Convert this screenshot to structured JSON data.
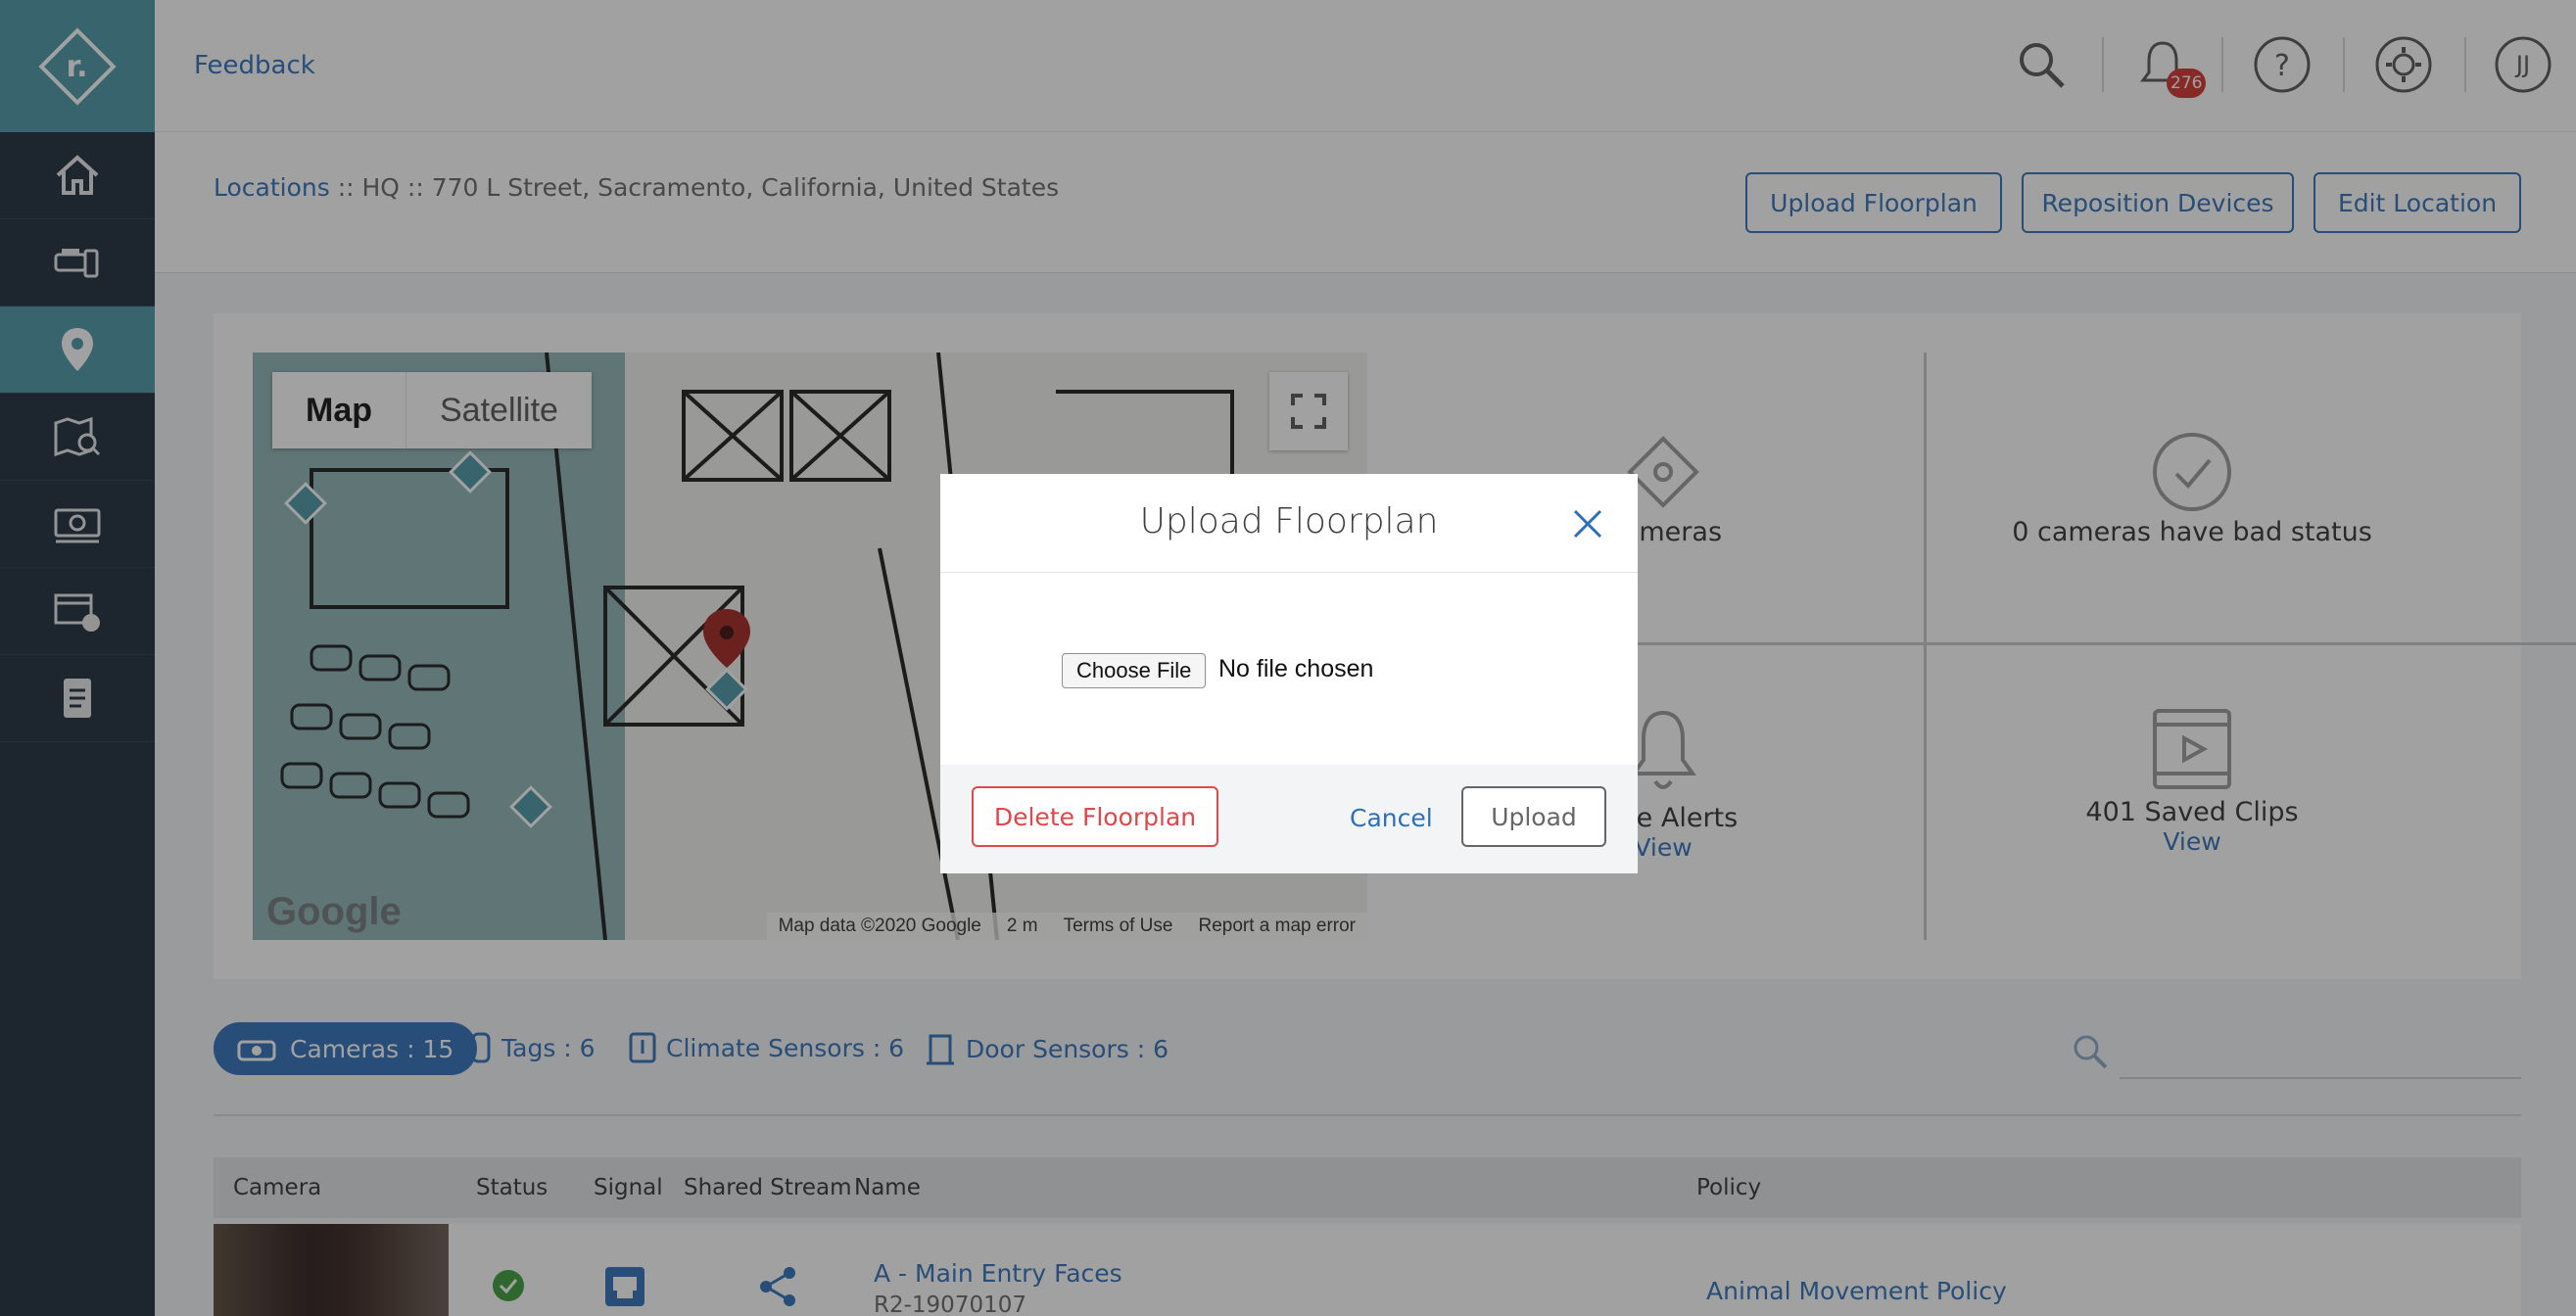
{
  "app": {
    "logo_text": "r."
  },
  "sidebar": {
    "items": [
      {
        "icon": "home-icon"
      },
      {
        "icon": "devices-icon"
      },
      {
        "icon": "location-pin-icon",
        "active": true
      },
      {
        "icon": "map-search-icon"
      },
      {
        "icon": "camera-icon"
      },
      {
        "icon": "video-clips-icon"
      },
      {
        "icon": "reports-icon"
      }
    ]
  },
  "header": {
    "feedback": "Feedback",
    "notification_count": "276",
    "user_initial": "JJ"
  },
  "breadcrumb": {
    "link": "Locations",
    "rest": " :: HQ :: 770 L Street, Sacramento, California, United States"
  },
  "actions": {
    "upload_floorplan": "Upload Floorplan",
    "reposition_devices": "Reposition Devices",
    "edit_location": "Edit Location"
  },
  "map": {
    "tab_map": "Map",
    "tab_satellite": "Satellite",
    "google": "Google",
    "map_data": "Map data ©2020 Google",
    "scale": "2 m",
    "terms": "Terms of Use",
    "report": "Report a map error"
  },
  "stats": {
    "cameras": "Cameras",
    "bad_status": "0 cameras have bad status",
    "active_alerts": "ctive Alerts",
    "alerts_link": "View",
    "saved_clips": "401 Saved Clips",
    "clips_link": "View"
  },
  "filters": {
    "cameras": "Cameras : 15",
    "tags": "Tags : 6",
    "climate": "Climate Sensors : 6",
    "door": "Door Sensors : 6"
  },
  "table": {
    "columns": [
      "Camera",
      "Status",
      "Signal",
      "Shared Stream",
      "Name",
      "Policy"
    ],
    "rows": [
      {
        "name": "A - Main Entry Faces",
        "serial": "R2-19070107",
        "policy": "Animal Movement Policy"
      }
    ]
  },
  "modal": {
    "title": "Upload Floorplan",
    "choose_file": "Choose File",
    "file_status": "No file chosen",
    "delete": "Delete Floorplan",
    "cancel": "Cancel",
    "upload": "Upload"
  },
  "colors": {
    "accent": "#2f6fb8",
    "teal": "#4a97a8",
    "sidebar": "#1d2b3a",
    "danger": "#e0474a",
    "badge": "#d0312d"
  }
}
